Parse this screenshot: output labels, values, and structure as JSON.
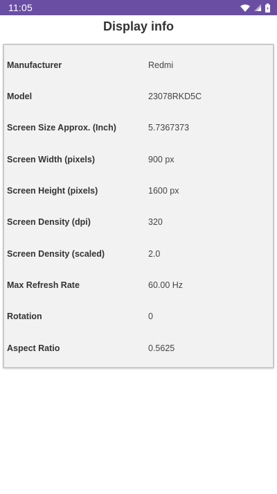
{
  "status_bar": {
    "time": "11:05",
    "background_color": "#6a4ea3",
    "icons": [
      "wifi-icon",
      "signal-icon",
      "battery-icon"
    ]
  },
  "page": {
    "title": "Display info"
  },
  "info_rows": [
    {
      "label": "Manufacturer",
      "value": "Redmi"
    },
    {
      "label": "Model",
      "value": "23078RKD5C"
    },
    {
      "label": "Screen Size Approx. (Inch)",
      "value": "5.7367373"
    },
    {
      "label": "Screen Width (pixels)",
      "value": "900 px"
    },
    {
      "label": "Screen Height (pixels)",
      "value": "1600 px"
    },
    {
      "label": "Screen Density (dpi)",
      "value": "320"
    },
    {
      "label": "Screen Density (scaled)",
      "value": "2.0"
    },
    {
      "label": "Max Refresh Rate",
      "value": "60.00 Hz"
    },
    {
      "label": "Rotation",
      "value": "0"
    },
    {
      "label": "Aspect Ratio",
      "value": "0.5625"
    }
  ]
}
